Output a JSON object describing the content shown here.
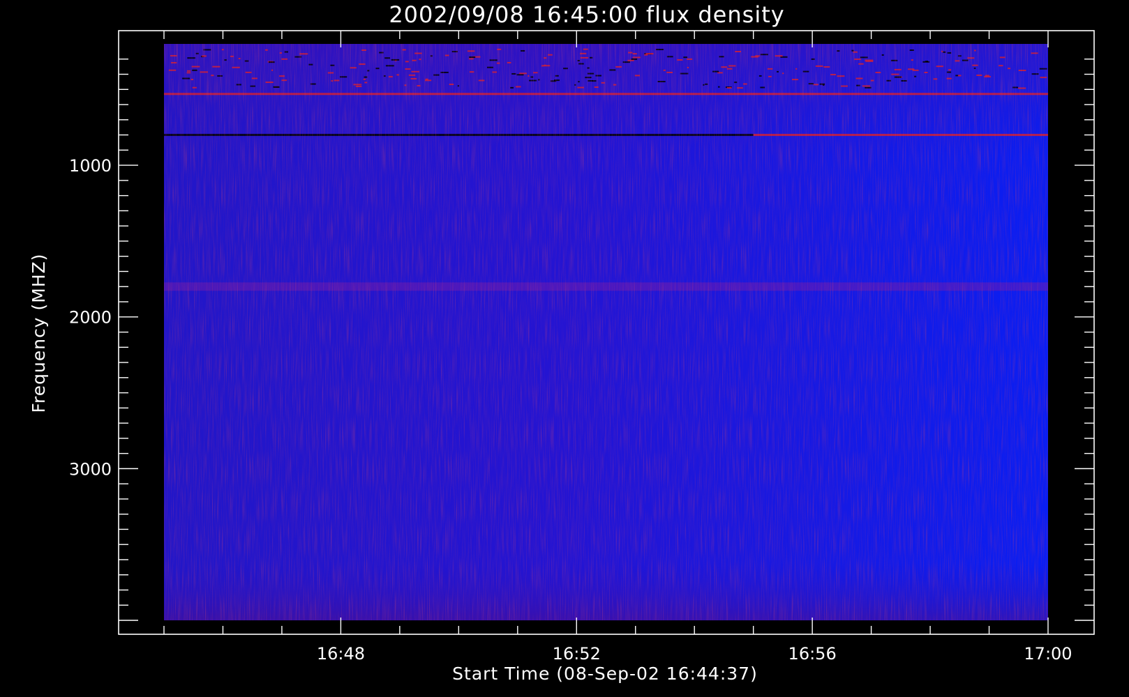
{
  "chart_data": {
    "type": "heatmap",
    "title": "2002/09/08 16:45:00 flux density",
    "xlabel": "Start Time (08-Sep-02 16:44:37)",
    "ylabel": "Frequency (MHZ)",
    "x_start": "16:45:00",
    "x_end": "17:00:00",
    "xlim_minutes": [
      16.75,
      17.0
    ],
    "x_ticks": [
      {
        "label": "16:48",
        "value": "16:48"
      },
      {
        "label": "16:52",
        "value": "16:52"
      },
      {
        "label": "16:56",
        "value": "16:56"
      },
      {
        "label": "17:00",
        "value": "17:00"
      }
    ],
    "ylim": [
      4000,
      200
    ],
    "y_ticks": [
      {
        "label": "1000",
        "value": 1000
      },
      {
        "label": "2000",
        "value": 2000
      },
      {
        "label": "3000",
        "value": 3000
      }
    ],
    "colormap": [
      "#000000",
      "#1f10c8",
      "#0a1cf0",
      "#c81030"
    ],
    "colors": {
      "background": "#000000",
      "axes": "#ffffff",
      "base": "#1a14e6",
      "hot": "#d21e32",
      "cold": "#000000"
    },
    "features": [
      {
        "kind": "band",
        "freq_mhz": 530,
        "start": "16:45",
        "end": "17:00",
        "level": "high"
      },
      {
        "kind": "band",
        "freq_mhz": 800,
        "start": "16:45",
        "end": "16:55",
        "level": "low"
      },
      {
        "kind": "band",
        "freq_mhz": 800,
        "start": "16:55",
        "end": "17:00",
        "level": "high"
      },
      {
        "kind": "band",
        "freq_mhz": 1800,
        "start": "16:45",
        "end": "17:00",
        "level": "medium"
      }
    ]
  }
}
